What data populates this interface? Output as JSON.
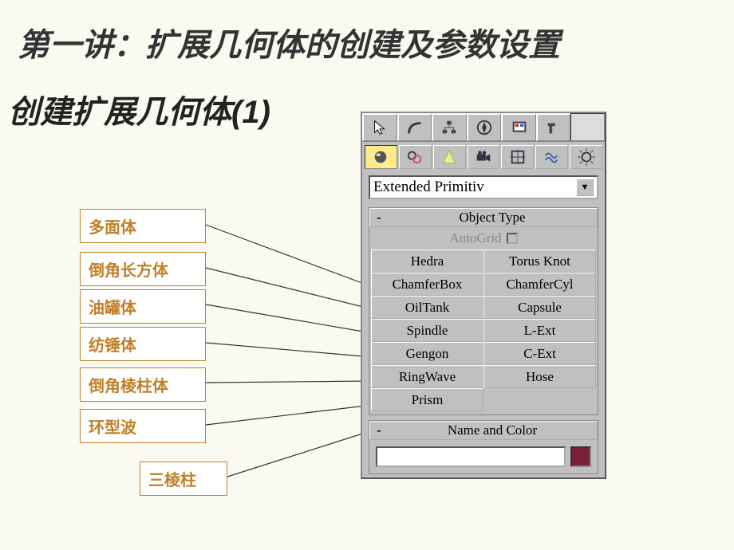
{
  "heading": {
    "main": "第一讲：扩展几何体的创建及参数设置",
    "sub": "创建扩展几何体(1)"
  },
  "labels": [
    "多面体",
    "倒角长方体",
    "油罐体",
    "纺锤体",
    "倒角棱柱体",
    "环型波",
    "三棱柱"
  ],
  "panel": {
    "dropdown": "Extended Primitiv",
    "rollouts": {
      "object_type": {
        "toggle": "-",
        "title": "Object Type",
        "autogrid_label": "AutoGrid",
        "buttons": [
          "Hedra",
          "Torus Knot",
          "ChamferBox",
          "ChamferCyl",
          "OilTank",
          "Capsule",
          "Spindle",
          "L-Ext",
          "Gengon",
          "C-Ext",
          "RingWave",
          "Hose",
          "Prism",
          ""
        ]
      },
      "name_color": {
        "toggle": "-",
        "title": "Name and Color",
        "color": "#7a1f3a"
      }
    },
    "icons": {
      "arrow": "arrow-cursor-icon",
      "arc": "arc-icon",
      "hierarchy": "hierarchy-icon",
      "compass": "compass-icon",
      "display": "display-icon",
      "hammer": "hammer-icon",
      "sphere": "geometry-icon",
      "shapes": "shapes-icon",
      "light": "light-icon",
      "camera": "camera-icon",
      "helper": "helper-icon",
      "spacewarp": "spacewarp-icon",
      "system": "system-icon"
    }
  }
}
